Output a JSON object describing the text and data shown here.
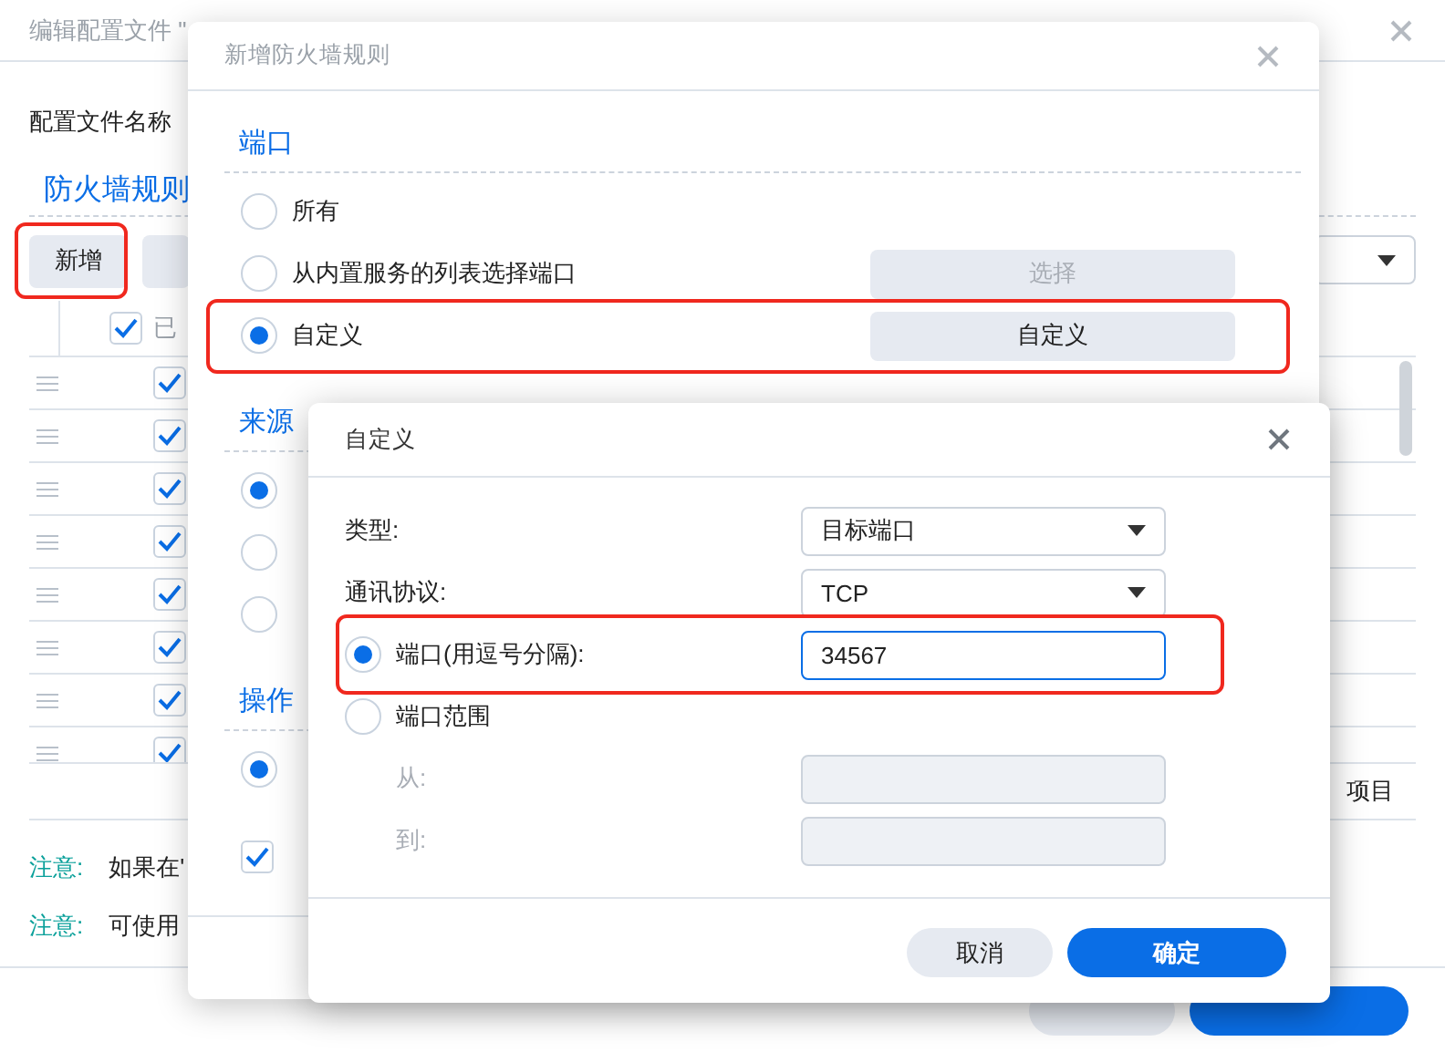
{
  "background_window": {
    "title": "编辑配置文件 \"",
    "profile_label": "配置文件名称",
    "section": "防火墙规则",
    "toolbar": [
      {
        "label": "新增",
        "highlighted": true
      },
      {
        "highlighted": false
      }
    ],
    "table": {
      "header": "已",
      "header_checked": true,
      "rows": [
        {
          "checked": true
        },
        {
          "checked": true
        },
        {
          "checked": true
        },
        {
          "checked": true
        },
        {
          "checked": true
        },
        {
          "checked": true
        },
        {
          "checked": true
        },
        {
          "checked": true
        }
      ]
    },
    "count_text": "项目",
    "notes": [
      {
        "label": "注意:",
        "text": "如果在'"
      },
      {
        "label": "注意:",
        "text": "可使用"
      }
    ],
    "buttons": [
      {
        "kind": "secondary"
      },
      {
        "kind": "primary"
      }
    ]
  },
  "rule_dialog": {
    "title": "新增防火墙规则",
    "sections": [
      {
        "heading": "端口",
        "options": [
          {
            "label": "所有",
            "selected": false
          },
          {
            "label": "从内置服务的列表选择端口",
            "selected": false,
            "button": {
              "label": "选择",
              "disabled": true
            }
          },
          {
            "label": "自定义",
            "selected": true,
            "highlighted": true,
            "button": {
              "label": "自定义",
              "disabled": false
            }
          }
        ]
      },
      {
        "heading": "来源",
        "options": [
          {
            "selected": true
          },
          {
            "selected": false
          },
          {
            "selected": false
          }
        ]
      },
      {
        "heading": "操作",
        "options": [
          {
            "selected": true
          }
        ]
      }
    ],
    "checkbox": {
      "checked": true
    }
  },
  "custom_dialog": {
    "title": "自定义",
    "rows": [
      {
        "kind": "select",
        "label": "类型:",
        "value": "目标端口"
      },
      {
        "kind": "select",
        "label": "通讯协议:",
        "value": "TCP"
      },
      {
        "kind": "radio-input",
        "label": "端口(用逗号分隔):",
        "selected": true,
        "value": "34567",
        "highlighted": true
      },
      {
        "kind": "radio",
        "label": "端口范围",
        "selected": false
      },
      {
        "kind": "input",
        "label": "从:",
        "disabled": true
      },
      {
        "kind": "input",
        "label": "到:",
        "disabled": true
      }
    ],
    "buttons": [
      {
        "label": "取消",
        "kind": "secondary"
      },
      {
        "label": "确定",
        "kind": "primary"
      }
    ]
  }
}
